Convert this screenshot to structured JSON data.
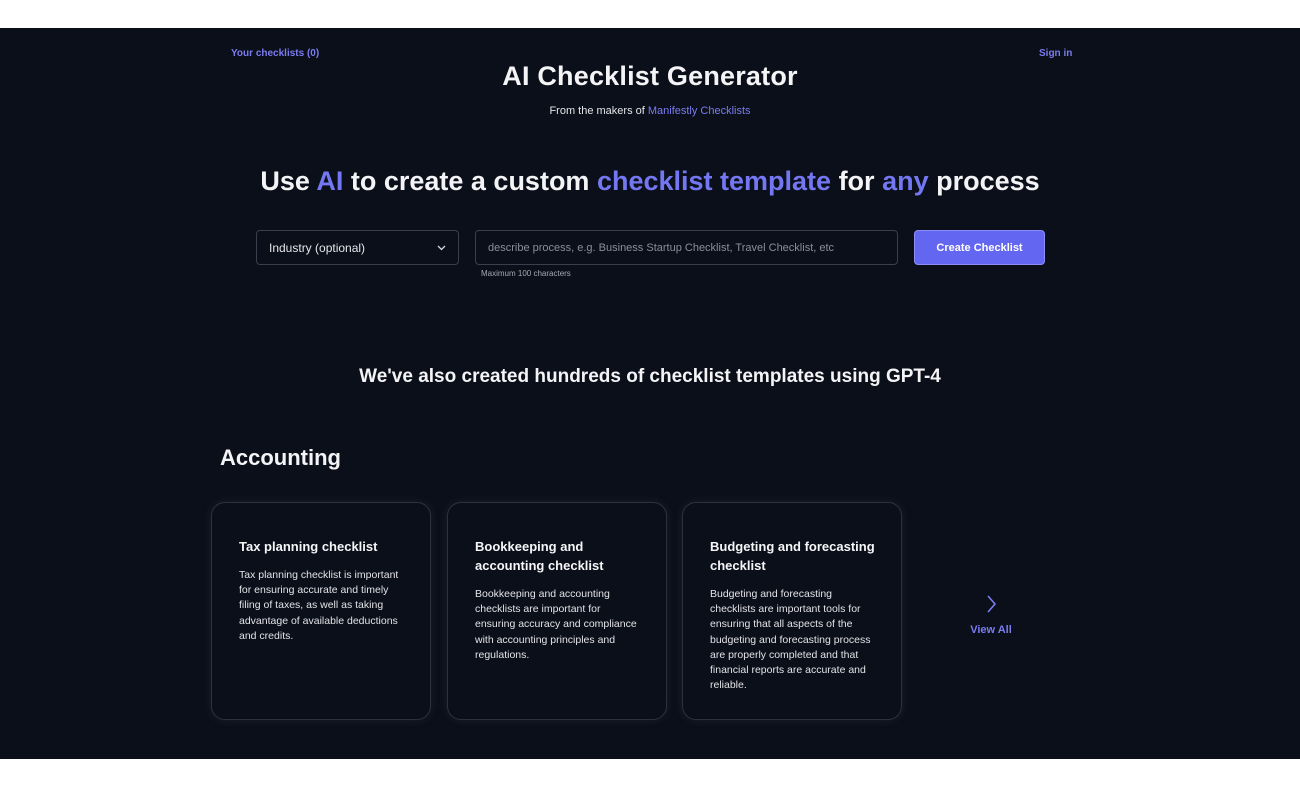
{
  "header": {
    "checklists_link": "Your checklists (0)",
    "signin_link": "Sign in",
    "title": "AI Checklist Generator",
    "subtitle_prefix": "From the makers of ",
    "subtitle_link": "Manifestly Checklists"
  },
  "hero": {
    "parts": [
      "Use ",
      "AI",
      " to create a custom ",
      "checklist template",
      " for ",
      "any",
      " process"
    ]
  },
  "form": {
    "industry_label": "Industry (optional)",
    "input_placeholder": "describe process, e.g. Business Startup Checklist, Travel Checklist, etc",
    "input_value": "",
    "hint": "Maximum 100 characters",
    "submit_label": "Create Checklist"
  },
  "templates": {
    "heading": "We've also created hundreds of checklist templates using GPT-4",
    "category": "Accounting",
    "cards": [
      {
        "title": "Tax planning checklist",
        "description": "Tax planning checklist is important for ensuring accurate and timely filing of taxes, as well as taking advantage of available deductions and credits."
      },
      {
        "title": "Bookkeeping and accounting checklist",
        "description": "Bookkeeping and accounting checklists are important for ensuring accuracy and compliance with accounting principles and regulations."
      },
      {
        "title": "Budgeting and forecasting checklist",
        "description": "Budgeting and forecasting checklists are important tools for ensuring that all aspects of the budgeting and forecasting process are properly completed and that financial reports are accurate and reliable."
      }
    ],
    "view_all_label": "View All"
  },
  "colors": {
    "background": "#0b0f19",
    "accent": "#6366f1",
    "highlight": "#7477f2"
  },
  "icons": {
    "select_chevron": "chevron-down-icon",
    "view_all_arrow": "chevron-right-icon"
  }
}
